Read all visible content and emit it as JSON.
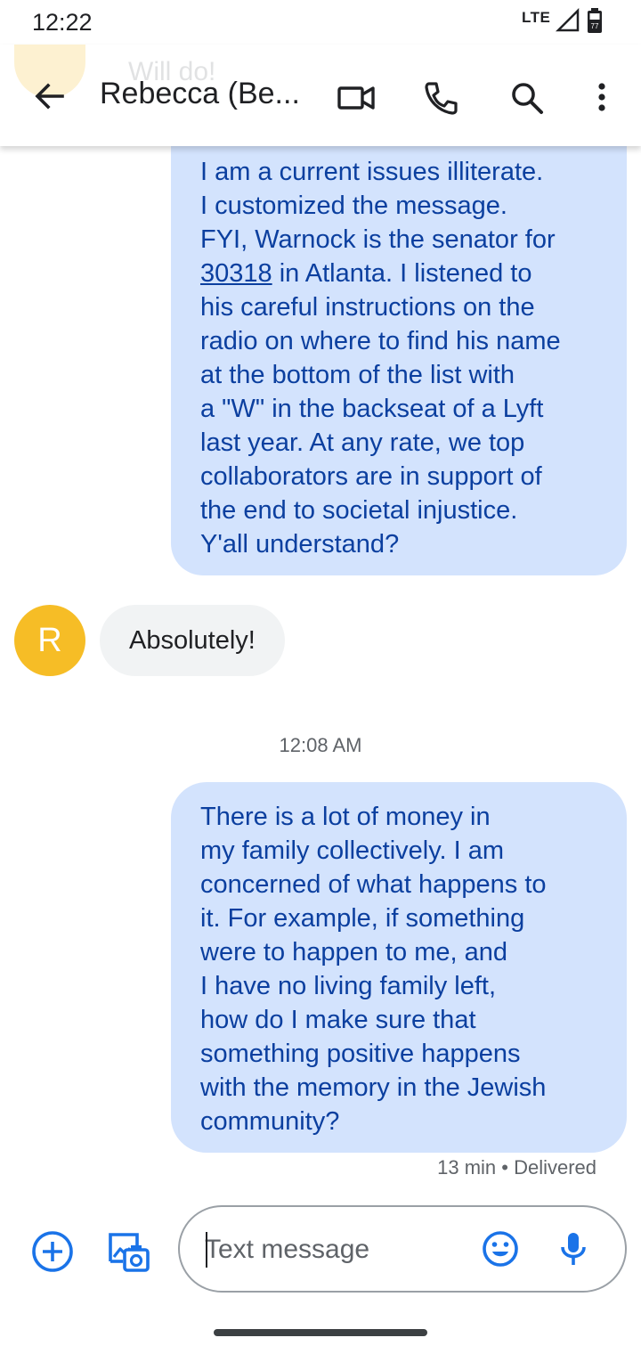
{
  "status_bar": {
    "time": "12:22",
    "network": "LTE",
    "battery_level": "77"
  },
  "app_bar": {
    "title": "Rebecca (Be...",
    "preview_text": "Will do!",
    "icons": [
      "back-arrow-icon",
      "video-call-icon",
      "phone-icon",
      "search-icon",
      "more-vert-icon"
    ]
  },
  "conversation": {
    "messages": [
      {
        "direction": "outgoing",
        "lines": [
          "I am a current issues illiterate.",
          "I customized the message.",
          "FYI, Warnock is the senator for",
          " in Atlanta. I listened to",
          "his careful instructions on the",
          "radio on where to find his name",
          "at the bottom of the list with",
          "a \"W\" in the backseat of a Lyft",
          "last year. At any rate, we top",
          "collaborators are in support of",
          "the end to societal injustice.",
          "Y'all understand?"
        ],
        "link_text": "30318"
      },
      {
        "direction": "incoming",
        "avatar_initial": "R",
        "text": "Absolutely!"
      },
      {
        "direction": "outgoing",
        "lines": [
          "There is a lot of money in",
          "my family collectively. I am",
          "concerned of what happens to",
          "it. For example, if something",
          "were to happen to me, and",
          "I have no living family left,",
          "how do I make sure that",
          "something positive happens",
          "with the memory in the Jewish",
          "community?"
        ]
      }
    ],
    "timestamp": "12:08 AM",
    "last_status": "13 min • Delivered"
  },
  "composer": {
    "placeholder": "Text message",
    "value": ""
  },
  "colors": {
    "outgoing_bubble": "#d3e3fd",
    "outgoing_text": "#0b3f9f",
    "incoming_bubble": "#f1f3f4",
    "avatar": "#f6bd26",
    "accent": "#1a73e8"
  }
}
